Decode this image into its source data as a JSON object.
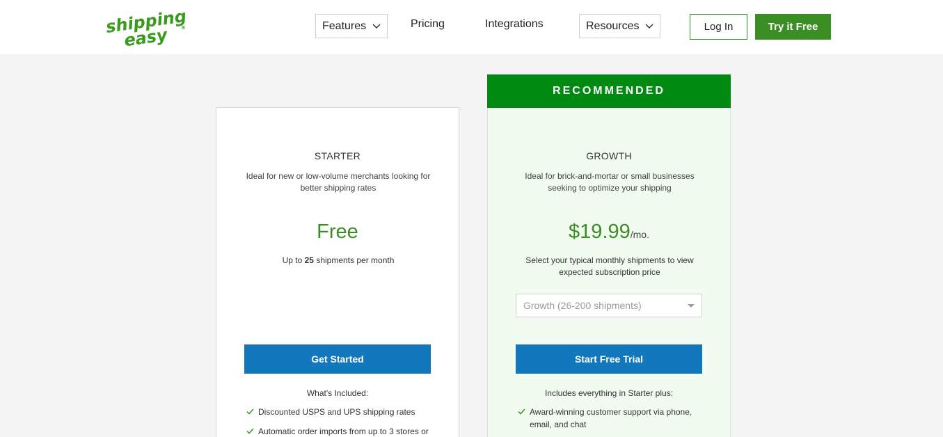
{
  "header": {
    "logo_text_top": "shipping",
    "logo_text_bottom": "easy",
    "logo_mark": "®",
    "nav": {
      "features": "Features",
      "pricing": "Pricing",
      "integrations": "Integrations",
      "resources": "Resources"
    },
    "login_label": "Log In",
    "try_label": "Try it Free"
  },
  "plans": {
    "recommended_label": "RECOMMENDED",
    "starter": {
      "name": "STARTER",
      "description": "Ideal for new or low-volume merchants looking for better shipping rates",
      "price": "Free",
      "note_prefix": "Up to",
      "note_count": "25",
      "note_suffix": "shipments per month",
      "cta_label": "Get Started",
      "included_heading": "What's Included:",
      "features": [
        "Discounted USPS and UPS shipping rates",
        "Automatic order imports from up to 3 stores or"
      ]
    },
    "growth": {
      "name": "GROWTH",
      "description": "Ideal for brick-and-mortar or small businesses seeking to optimize your shipping",
      "price": "$19.99",
      "price_unit": "/mo.",
      "note": "Select your typical monthly shipments to view expected subscription price",
      "select_value": "Growth (26-200 shipments)",
      "cta_label": "Start Free Trial",
      "included_heading": "Includes everything in Starter plus:",
      "features": [
        "Award-winning customer support via phone, email, and chat"
      ]
    }
  },
  "colors": {
    "brand_green": "#3a8e24",
    "recommended_green": "#008a12",
    "cta_blue": "#1278be",
    "growth_bg": "#f1fbef"
  },
  "icons": {
    "chevron": "chevron-down-icon",
    "check": "check-icon",
    "caret": "caret-down-icon"
  }
}
